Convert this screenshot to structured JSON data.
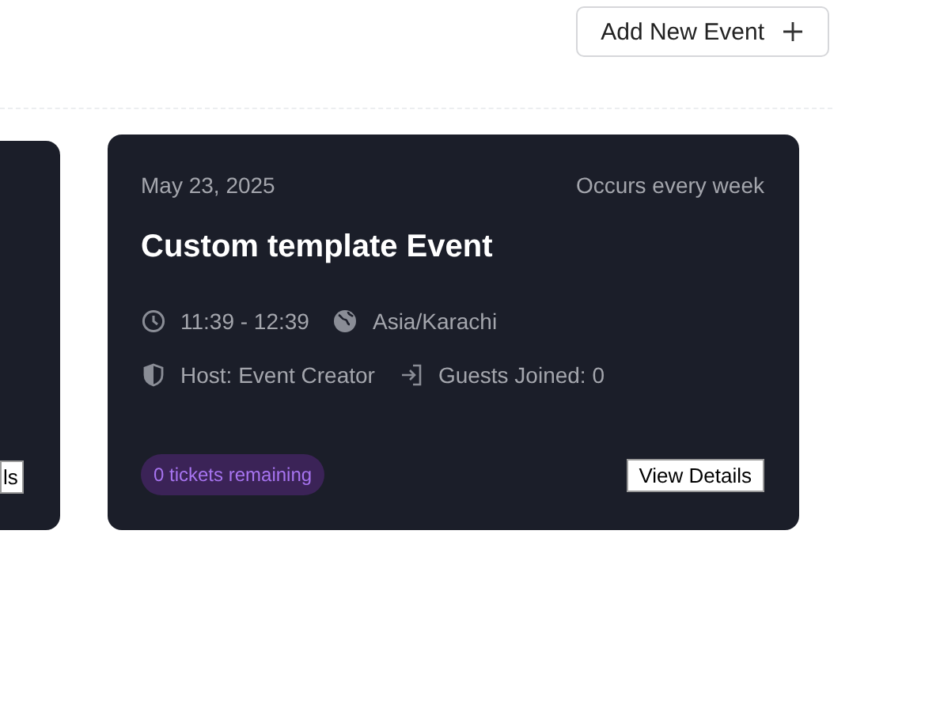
{
  "header": {
    "add_button": {
      "label": "Add New Event"
    }
  },
  "events": [
    {
      "kind": "partial",
      "view_button": "ls"
    },
    {
      "kind": "full",
      "date": "May 23, 2025",
      "recurrence": "Occurs every week",
      "title": "Custom template Event",
      "time": "11:39 - 12:39",
      "timezone": "Asia/Karachi",
      "host": "Host: Event Creator",
      "guests": "Guests Joined: 0",
      "tickets": "0 tickets remaining",
      "view_button": "View Details"
    }
  ]
}
